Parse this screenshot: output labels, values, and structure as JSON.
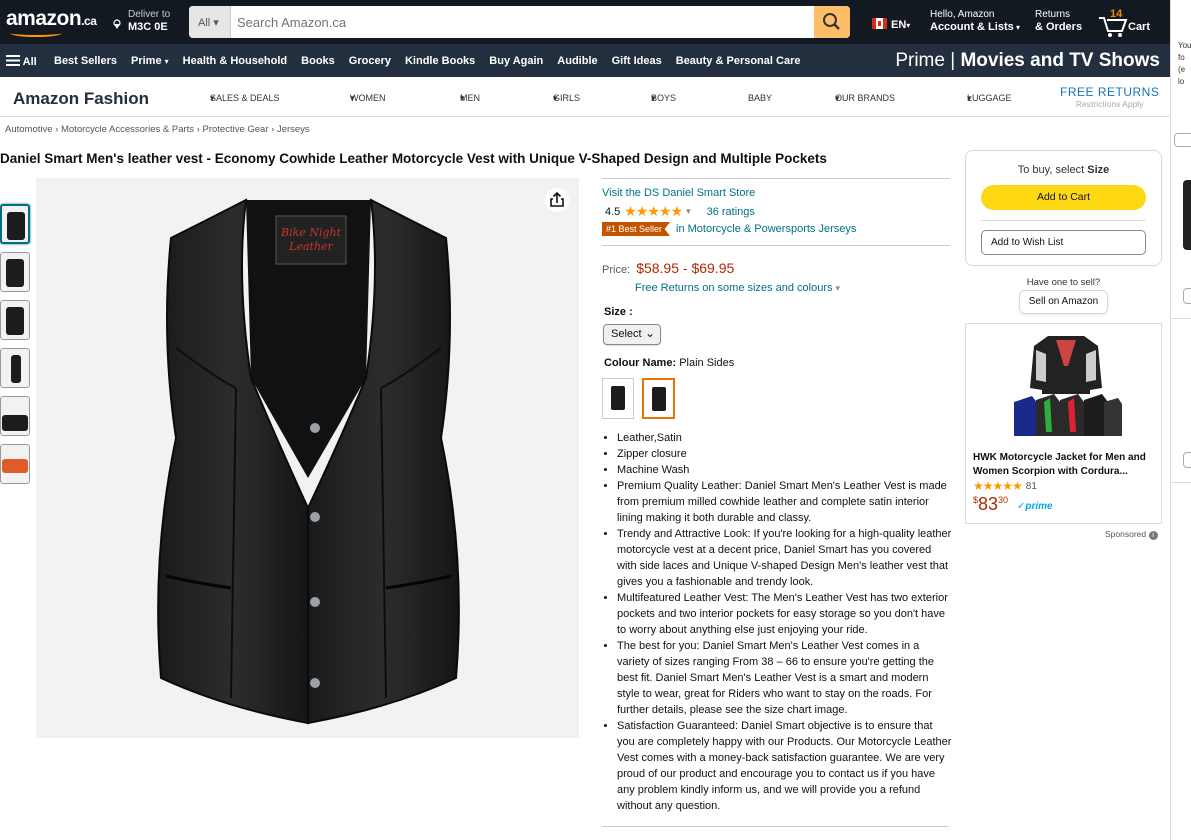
{
  "header": {
    "logo_text": "amazon",
    "logo_suffix": ".ca",
    "deliver_label": "Deliver to",
    "deliver_code": "M3C 0E",
    "search_category": "All",
    "search_placeholder": "Search Amazon.ca",
    "language": "EN",
    "account_line1": "Hello, Amazon",
    "account_line2": "Account & Lists",
    "orders_line1": "Returns",
    "orders_line2": "& Orders",
    "cart_count": "14",
    "cart_label": "Cart"
  },
  "nav": {
    "all_label": "All",
    "items": [
      "Best Sellers",
      "Prime",
      "Health & Household",
      "Books",
      "Grocery",
      "Kindle Books",
      "Buy Again",
      "Audible",
      "Gift Ideas",
      "Beauty & Personal Care"
    ],
    "prime_left": "Prime",
    "prime_right": "Movies and TV Shows"
  },
  "fashion": {
    "brand": "Amazon Fashion",
    "menu": [
      "SALES & DEALS",
      "WOMEN",
      "MEN",
      "GIRLS",
      "BOYS",
      "BABY",
      "OUR BRANDS",
      "LUGGAGE"
    ],
    "free_returns": "FREE RETURNS",
    "restrictions": "Restrictions Apply"
  },
  "breadcrumb": [
    "Automotive",
    "Motorcycle Accessories & Parts",
    "Protective Gear",
    "Jerseys"
  ],
  "product": {
    "title": "Daniel Smart Men's leather vest - Economy Cowhide Leather Motorcycle Vest with Unique V-Shaped Design and Multiple Pockets",
    "label_text_line1": "Bike Night",
    "label_text_line2": "Leather",
    "store": "Visit the DS Daniel Smart Store",
    "rating": "4.5",
    "rating_count": "36 ratings",
    "best_seller": "#1 Best Seller",
    "best_seller_category": "in Motorcycle & Powersports Jerseys",
    "price_label": "Price:",
    "price": "$58.95 - $69.95",
    "free_returns": "Free Returns on some sizes and colours",
    "size_label": "Size :",
    "size_selected": "Select",
    "colour_label": "Colour Name:",
    "colour_value": "Plain Sides",
    "bullets": [
      "Leather,Satin",
      "Zipper closure",
      "Machine Wash",
      "Premium Quality Leather: Daniel Smart Men's Leather Vest is made from premium milled cowhide leather and complete satin interior lining making it both durable and classy.",
      "Trendy and Attractive Look: If you're looking for a high-quality leather motorcycle vest at a decent price, Daniel Smart has you covered with side laces and Unique V-shaped Design Men's leather vest that gives you a fashionable and trendy look.",
      "Multifeatured Leather Vest: The Men's Leather Vest has two exterior pockets and two interior pockets for easy storage so you don't have to worry about anything else just enjoying your ride.",
      "The best for you: Daniel Smart Men's Leather Vest comes in a variety of sizes ranging From 38 – 66 to ensure you're getting the best fit. Daniel Smart Men's Leather Vest is a smart and modern style to wear, great for Riders who want to stay on the roads. For further details, please see the size chart image.",
      "Satisfaction Guaranteed: Daniel Smart objective is to ensure that you are completely happy with our Products. Our Motorcycle Leather Vest comes with a money-back satisfaction guarantee. We are very proud of our product and encourage you to contact us if you have any problem kindly inform us, and we will provide you a refund without any question."
    ]
  },
  "buybox": {
    "select_prefix": "To buy, select",
    "select_field": "Size",
    "add_to_cart": "Add to Cart",
    "add_to_wishlist": "Add to Wish List",
    "have_one": "Have one to sell?",
    "sell_button": "Sell on Amazon"
  },
  "ad": {
    "title": "HWK Motorcycle Jacket for Men and Women Scorpion with Cordura...",
    "rating_count": "81",
    "price_symbol": "$",
    "price_whole": "83",
    "price_frac": "30",
    "prime": "prime",
    "sponsored": "Sponsored"
  },
  "right_strip": [
    "You",
    "fo",
    "(e",
    "lo"
  ],
  "colors": {
    "header_bg": "#131921",
    "nav_bg": "#232f3e",
    "accent_orange": "#ff9900",
    "link": "#007185",
    "price_red": "#b12704",
    "add_to_cart_yellow": "#ffd814",
    "best_seller_badge": "#c45500"
  },
  "icons": [
    "location-pin-icon",
    "search-icon",
    "canada-flag-icon",
    "cart-icon",
    "hamburger-icon",
    "share-icon",
    "chevron-down-icon",
    "info-icon"
  ]
}
